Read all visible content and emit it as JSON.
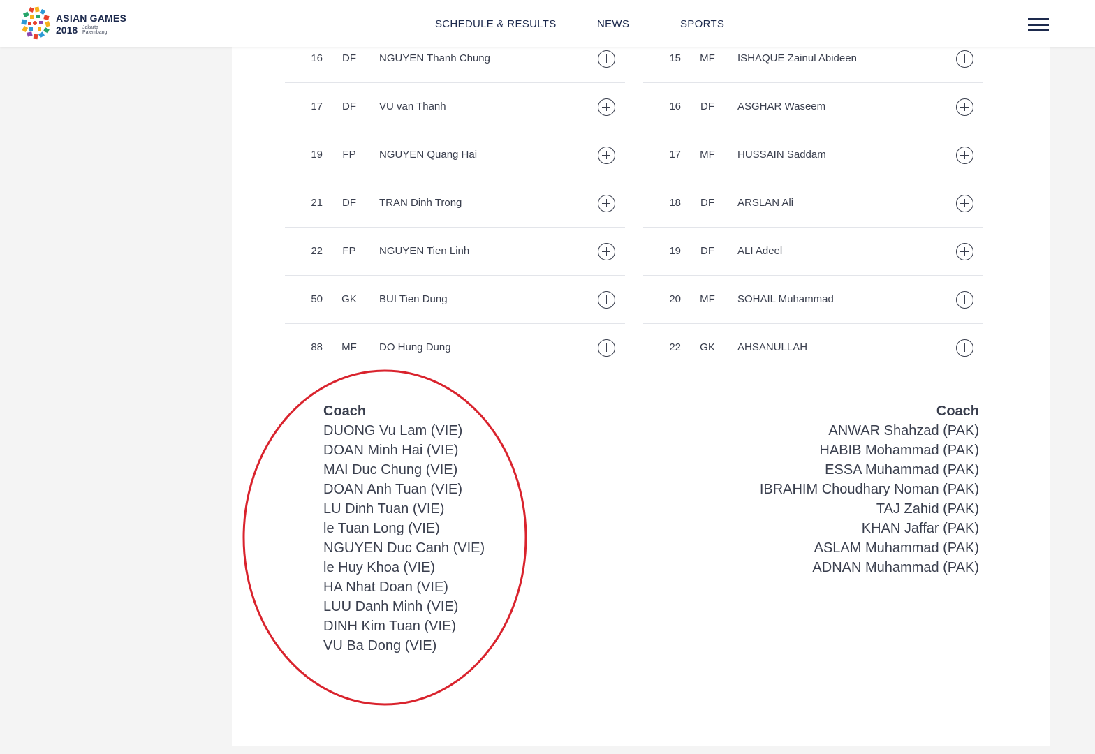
{
  "header": {
    "logo": {
      "title": "ASIAN GAMES",
      "year": "2018",
      "city1": "Jakarta",
      "city2": "Palembang"
    },
    "nav": [
      {
        "label": "SCHEDULE & RESULTS"
      },
      {
        "label": "NEWS"
      },
      {
        "label": "SPORTS"
      }
    ],
    "menu_icon": "hamburger-icon"
  },
  "rosters": {
    "left": [
      {
        "num": "16",
        "pos": "DF",
        "name": "NGUYEN Thanh Chung"
      },
      {
        "num": "17",
        "pos": "DF",
        "name": "VU van Thanh"
      },
      {
        "num": "19",
        "pos": "FP",
        "name": "NGUYEN Quang Hai"
      },
      {
        "num": "21",
        "pos": "DF",
        "name": "TRAN Dinh Trong"
      },
      {
        "num": "22",
        "pos": "FP",
        "name": "NGUYEN Tien Linh"
      },
      {
        "num": "50",
        "pos": "GK",
        "name": "BUI Tien Dung"
      },
      {
        "num": "88",
        "pos": "MF",
        "name": "DO Hung Dung"
      }
    ],
    "right": [
      {
        "num": "15",
        "pos": "MF",
        "name": "ISHAQUE Zainul Abideen"
      },
      {
        "num": "16",
        "pos": "DF",
        "name": "ASGHAR Waseem"
      },
      {
        "num": "17",
        "pos": "MF",
        "name": "HUSSAIN Saddam"
      },
      {
        "num": "18",
        "pos": "DF",
        "name": "ARSLAN Ali"
      },
      {
        "num": "19",
        "pos": "DF",
        "name": "ALI Adeel"
      },
      {
        "num": "20",
        "pos": "MF",
        "name": "SOHAIL Muhammad"
      },
      {
        "num": "22",
        "pos": "GK",
        "name": "AHSANULLAH"
      }
    ]
  },
  "coaches": {
    "left": {
      "heading": "Coach",
      "names": [
        "DUONG Vu Lam (VIE)",
        "DOAN Minh Hai (VIE)",
        "MAI Duc Chung (VIE)",
        "DOAN Anh Tuan (VIE)",
        "LU Dinh Tuan (VIE)",
        "le Tuan Long (VIE)",
        "NGUYEN Duc Canh (VIE)",
        "le Huy Khoa (VIE)",
        "HA Nhat Doan (VIE)",
        "LUU Danh Minh (VIE)",
        "DINH Kim Tuan (VIE)",
        "VU Ba Dong (VIE)"
      ]
    },
    "right": {
      "heading": "Coach",
      "names": [
        "ANWAR Shahzad (PAK)",
        "HABIB Mohammad (PAK)",
        "ESSA Muhammad (PAK)",
        "IBRAHIM Choudhary Noman (PAK)",
        "TAJ Zahid (PAK)",
        "KHAN Jaffar (PAK)",
        "ASLAM Muhammad (PAK)",
        "ADNAN Muhammad (PAK)"
      ]
    }
  },
  "colors": {
    "brand_navy": "#1d2a4d",
    "text": "#3a3f4e",
    "annotation_red": "#d9232d",
    "page_bg": "#f4f4f4"
  }
}
